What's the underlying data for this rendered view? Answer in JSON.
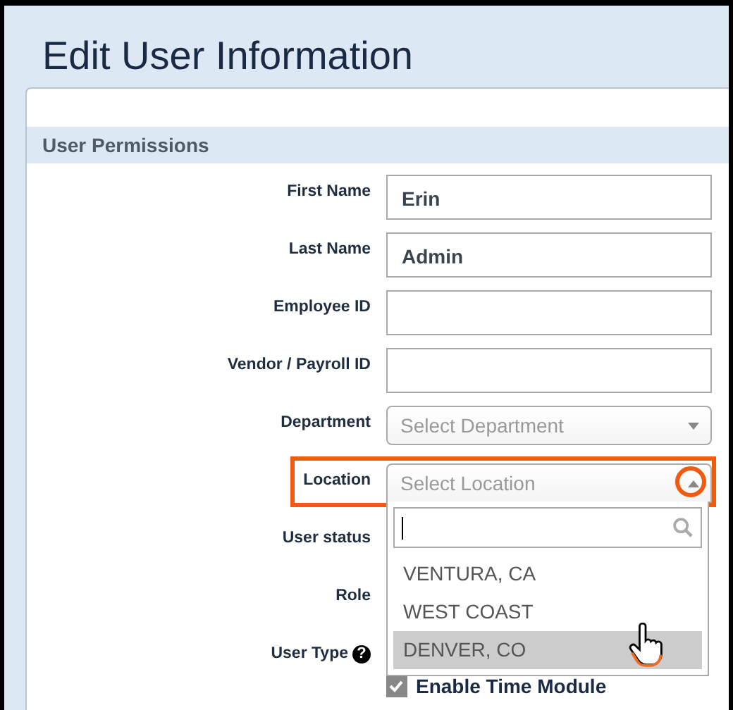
{
  "title": "Edit User Information",
  "section": "User Permissions",
  "fields": [
    {
      "kind": "text",
      "label": "First Name",
      "value": "Erin"
    },
    {
      "kind": "text",
      "label": "Last Name",
      "value": "Admin"
    },
    {
      "kind": "text",
      "label": "Employee ID"
    },
    {
      "kind": "text",
      "label": "Vendor / Payroll ID"
    },
    {
      "kind": "select",
      "label": "Department",
      "placeholder": "Select Department",
      "expanded": false,
      "highlighted": false
    },
    {
      "kind": "select",
      "label": "Location",
      "placeholder": "Select Location",
      "expanded": true,
      "highlighted": true,
      "options": [
        {
          "label": "VENTURA, CA",
          "selected": false
        },
        {
          "label": "WEST COAST",
          "selected": false
        },
        {
          "label": "DENVER, CO",
          "selected": true
        }
      ]
    },
    {
      "kind": "blank",
      "label": "User status"
    },
    {
      "kind": "blank",
      "label": "Role"
    },
    {
      "kind": "blank",
      "label": "User Type",
      "help": "?"
    }
  ],
  "checkbox": {
    "label": "Enable Time Module",
    "checked": true
  }
}
